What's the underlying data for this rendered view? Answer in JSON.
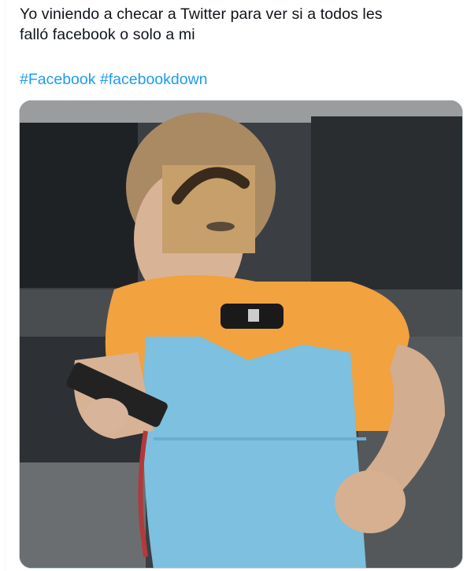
{
  "tweet": {
    "text_line1": "Yo viniendo a checar a Twitter para ver si a todos les",
    "text_line2": "falló facebook o solo a mi",
    "hashtags": [
      "#Facebook",
      "#facebookdown"
    ]
  },
  "media": {
    "type": "photo",
    "description_icon": "meme-photo",
    "colors": {
      "shirt": "#f3a33f",
      "apron": "#7ec1e0",
      "background": "#3a3e42",
      "skin": "#d9b79a"
    }
  }
}
